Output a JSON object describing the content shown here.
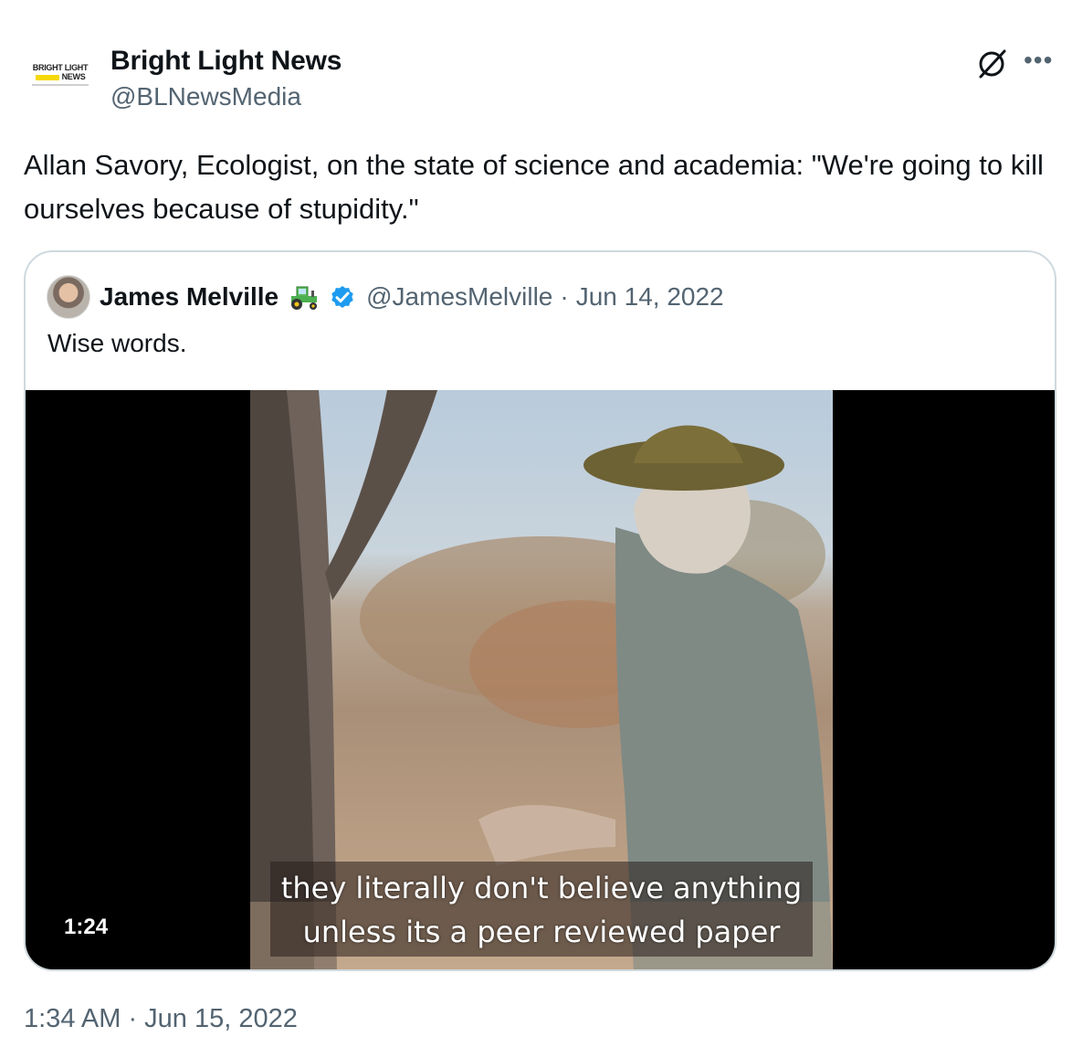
{
  "author": {
    "name": "Bright Light News",
    "handle": "@BLNewsMedia",
    "logo_text_top": "BRIGHT LIGHT",
    "logo_text_bottom": "NEWS"
  },
  "icons": {
    "grok": "grok-icon",
    "more": "more-icon",
    "verified": "verified-badge-icon",
    "tractor": "tractor-emoji-icon"
  },
  "tweet": {
    "text": "Allan Savory, Ecologist, on the state of science and academia: \"We're going to kill ourselves because of stupidity.\"",
    "timestamp": "1:34 AM · Jun 15, 2022"
  },
  "quote": {
    "name": "James Melville",
    "handle": "@JamesMelville",
    "separator": "·",
    "date": "Jun 14, 2022",
    "text": "Wise words.",
    "video": {
      "duration": "1:24",
      "subtitle_line1": "they literally don't believe anything",
      "subtitle_line2": "unless its a peer reviewed paper"
    }
  },
  "colors": {
    "text_primary": "#0f1419",
    "text_secondary": "#536471",
    "border": "#cfd9de",
    "verified_blue": "#1d9bf0"
  }
}
